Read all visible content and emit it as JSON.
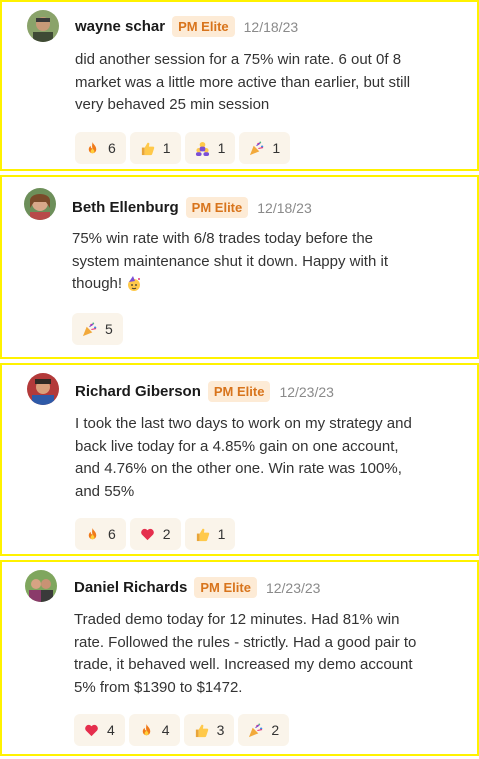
{
  "posts": [
    {
      "author": "wayne schar",
      "badge": "PM Elite",
      "date": "12/18/23",
      "lines": [
        "did another session for a 75% win rate. 6 out 0f 8",
        "market was a little more active than earlier, but still",
        "very behaved 25 min session"
      ],
      "reactions": [
        {
          "icon": "fire-icon",
          "count": "6"
        },
        {
          "icon": "thumbs-up-icon",
          "count": "1"
        },
        {
          "icon": "people-icon",
          "count": "1"
        },
        {
          "icon": "party-popper-icon",
          "count": "1"
        }
      ]
    },
    {
      "author": "Beth Ellenburg",
      "badge": "PM Elite",
      "date": "12/18/23",
      "lines": [
        "75% win rate with 6/8 trades today before the",
        "system maintenance shut it down. Happy with it",
        "though!"
      ],
      "trailing_emoji": "party-face-icon",
      "reactions": [
        {
          "icon": "party-popper-icon",
          "count": "5"
        }
      ]
    },
    {
      "author": "Richard Giberson",
      "badge": "PM Elite",
      "date": "12/23/23",
      "lines": [
        "I took the last two days to work on my strategy and",
        "back live today for a 4.85% gain on one account,",
        "and 4.76% on the other one. Win rate was 100%,",
        "and 55%"
      ],
      "reactions": [
        {
          "icon": "fire-icon",
          "count": "6"
        },
        {
          "icon": "heart-icon",
          "count": "2"
        },
        {
          "icon": "thumbs-up-icon",
          "count": "1"
        }
      ]
    },
    {
      "author": "Daniel Richards",
      "badge": "PM Elite",
      "date": "12/23/23",
      "lines": [
        "Traded demo today for 12 minutes. Had 81% win",
        "rate. Followed the rules - strictly. Had a good pair to",
        "trade, it behaved well. Increased my demo account",
        "5% from $1390 to $1472."
      ],
      "reactions": [
        {
          "icon": "heart-icon",
          "count": "4"
        },
        {
          "icon": "fire-icon",
          "count": "4"
        },
        {
          "icon": "thumbs-up-icon",
          "count": "3"
        },
        {
          "icon": "party-popper-icon",
          "count": "2"
        }
      ]
    }
  ]
}
